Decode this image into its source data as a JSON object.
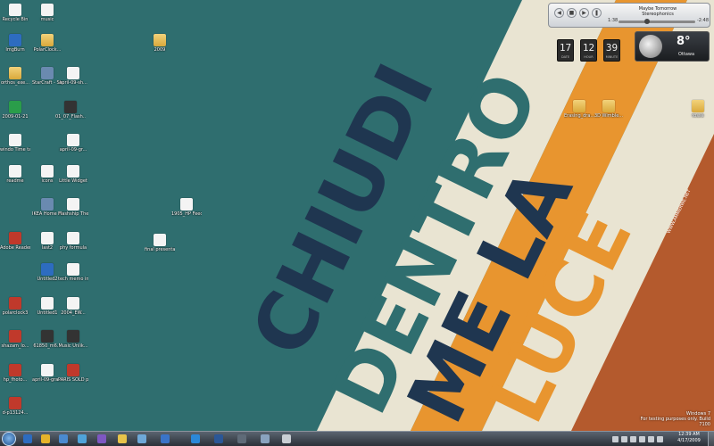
{
  "desktop_icons": [
    {
      "label": "Recycle Bin",
      "style": "doc"
    },
    {
      "label": "music",
      "style": "doc"
    },
    {
      "label": "ImgBurn",
      "style": "blue"
    },
    {
      "label": "PolarClock...",
      "style": "folder"
    },
    {
      "label": "2009",
      "style": "folder"
    },
    {
      "label": "orthos_exe...",
      "style": "folder"
    },
    {
      "label": "StarCraft - Shortcut",
      "style": "app"
    },
    {
      "label": "april-09-sh...",
      "style": "doc"
    },
    {
      "label": "2009-01-21",
      "style": "green"
    },
    {
      "label": "01_07_Flash...",
      "style": "dark"
    },
    {
      "label": "windo Time table",
      "style": "doc"
    },
    {
      "label": "april-09-gr...",
      "style": "doc"
    },
    {
      "label": "readme",
      "style": "doc"
    },
    {
      "label": "icons",
      "style": "doc"
    },
    {
      "label": "Little Widget",
      "style": "doc"
    },
    {
      "label": "IKEA Home Planner",
      "style": "app"
    },
    {
      "label": "Flashship Theme",
      "style": "doc"
    },
    {
      "label": "1905_HP Feedback dir...",
      "style": "doc"
    },
    {
      "label": "Adobe Reader 9",
      "style": "red"
    },
    {
      "label": "last2",
      "style": "doc"
    },
    {
      "label": "phy formula",
      "style": "doc"
    },
    {
      "label": "final presentation",
      "style": "doc"
    },
    {
      "label": "Untitled2",
      "style": "blue"
    },
    {
      "label": "tech memo instructions",
      "style": "doc"
    },
    {
      "label": "polarclock3",
      "style": "red"
    },
    {
      "label": "Untitled1",
      "style": "doc"
    },
    {
      "label": "2004_EW...",
      "style": "doc"
    },
    {
      "label": "shazam_lo...",
      "style": "red"
    },
    {
      "label": "61850_m6...",
      "style": "dark"
    },
    {
      "label": "Music Unlik...",
      "style": "dark"
    },
    {
      "label": "hp_fhoto...",
      "style": "red"
    },
    {
      "label": "april-09-gra...",
      "style": "doc"
    },
    {
      "label": "PARIS SOLD presents_0...",
      "style": "red"
    },
    {
      "label": "d-p13124...",
      "style": "red"
    },
    {
      "label": "Erasing_dra...",
      "style": "folder"
    },
    {
      "label": "3D Wimble...",
      "style": "folder"
    },
    {
      "label": "tosse",
      "style": "folder"
    }
  ],
  "wallpaper": {
    "lines": [
      "CHIUDI",
      "DENTRO",
      "ME LA",
      "LUCE"
    ],
    "credit": "WWW.AMMERWE.NET"
  },
  "media_player": {
    "track": "Maybe Tomorrow",
    "artist": "Stereophonics",
    "elapsed": "1:38",
    "remaining": "-2:48",
    "progress": 0.37
  },
  "clock": {
    "segments": [
      {
        "value": "17",
        "label": "DATE"
      },
      {
        "value": "12",
        "label": "HOUR"
      },
      {
        "value": "39",
        "label": "MINUTE"
      }
    ]
  },
  "weather": {
    "temperature": "8°",
    "city": "Ottawa"
  },
  "watermark": {
    "line1": "Windows 7",
    "line2": "For testing purposes only. Build 7100"
  },
  "taskbar": {
    "time": "12:39 AM",
    "date": "4/17/2009",
    "pinned": [
      "browser",
      "chrome",
      "network",
      "music-app",
      "media-player",
      "folder-app",
      "search-app",
      "blue-app",
      "windows-app",
      "word-app",
      "screen-app",
      "tools-app",
      "paint-app"
    ]
  },
  "colors": {
    "teal": "#2f6e6f",
    "cream": "#e9e4d2",
    "orange": "#e8952f",
    "navy": "#1f3650",
    "rust": "#b45a2d"
  }
}
